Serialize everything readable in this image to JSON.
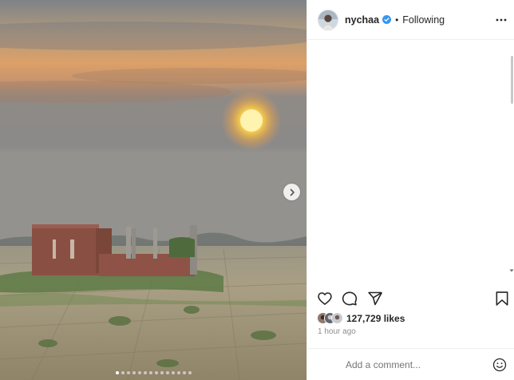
{
  "post": {
    "username": "nychaa",
    "separator": "•",
    "follow_status": "Following",
    "likes": "127,729 likes",
    "time_ago": "1 hour ago",
    "comment_placeholder": "Add a comment..."
  },
  "carousel": {
    "slide_count": 14,
    "active_index": 0
  },
  "colors": {
    "verified_badge": "#3897f0",
    "text_primary": "#262626",
    "text_secondary": "#8e8e8e",
    "divider": "#efefef"
  },
  "icons": {
    "next": "chevron-right-icon",
    "verified": "verified-badge-icon",
    "more": "more-options-icon",
    "like": "heart-icon",
    "comment": "comment-bubble-icon",
    "share": "paper-plane-icon",
    "save": "bookmark-icon",
    "emoji": "smiley-face-icon"
  }
}
